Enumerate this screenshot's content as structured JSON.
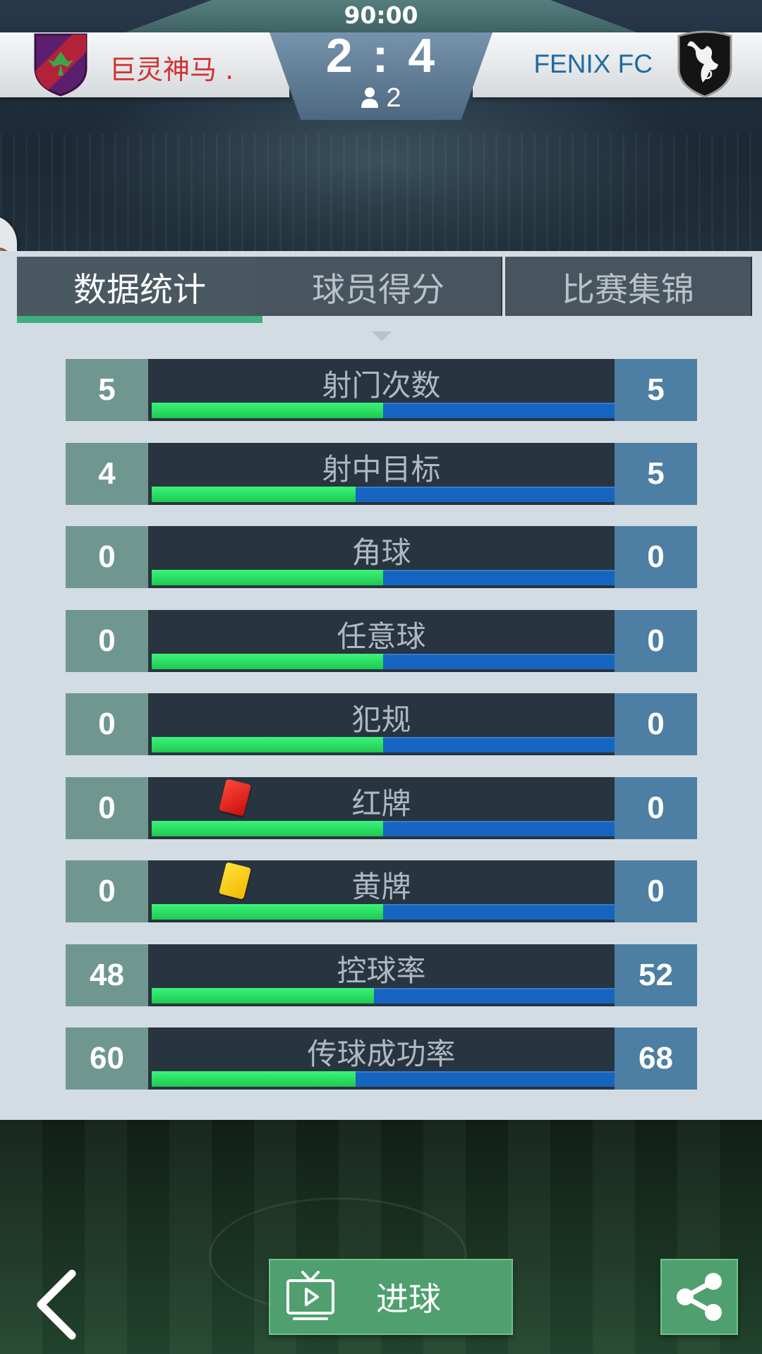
{
  "match": {
    "timer": "90:00",
    "home_score": "2",
    "away_score": "4",
    "score_separator": ":",
    "spectators": "2",
    "home_team": {
      "name": "巨灵神马 .",
      "name_color": "#d0322e"
    },
    "away_team": {
      "name": "FENIX FC",
      "name_color": "#1f6aa1"
    }
  },
  "tabs": [
    {
      "label": "数据统计",
      "active": true
    },
    {
      "label": "球员得分",
      "active": false
    },
    {
      "label": "比赛集锦",
      "active": false
    }
  ],
  "stats": [
    {
      "label": "射门次数",
      "home": "5",
      "away": "5",
      "home_share": 0.5
    },
    {
      "label": "射中目标",
      "home": "4",
      "away": "5",
      "home_share": 0.44
    },
    {
      "label": "角球",
      "home": "0",
      "away": "0",
      "home_share": 0.5
    },
    {
      "label": "任意球",
      "home": "0",
      "away": "0",
      "home_share": 0.5
    },
    {
      "label": "犯规",
      "home": "0",
      "away": "0",
      "home_share": 0.5
    },
    {
      "label": "红牌",
      "home": "0",
      "away": "0",
      "home_share": 0.5,
      "icon": "red-card-icon"
    },
    {
      "label": "黄牌",
      "home": "0",
      "away": "0",
      "home_share": 0.5,
      "icon": "yellow-card-icon"
    },
    {
      "label": "控球率",
      "home": "48",
      "away": "52",
      "home_share": 0.48
    },
    {
      "label": "传球成功率",
      "home": "60",
      "away": "68",
      "home_share": 0.44
    }
  ],
  "footer": {
    "goals_button_label": "进球",
    "back_icon": "back-arrow-icon",
    "share_icon": "share-icon"
  },
  "colors": {
    "home_bar": "#1ec94f",
    "away_bar": "#1565c0",
    "home_value_bg": "#6f9790",
    "away_value_bg": "#4c7fa3",
    "button_green": "#4fa06e"
  }
}
